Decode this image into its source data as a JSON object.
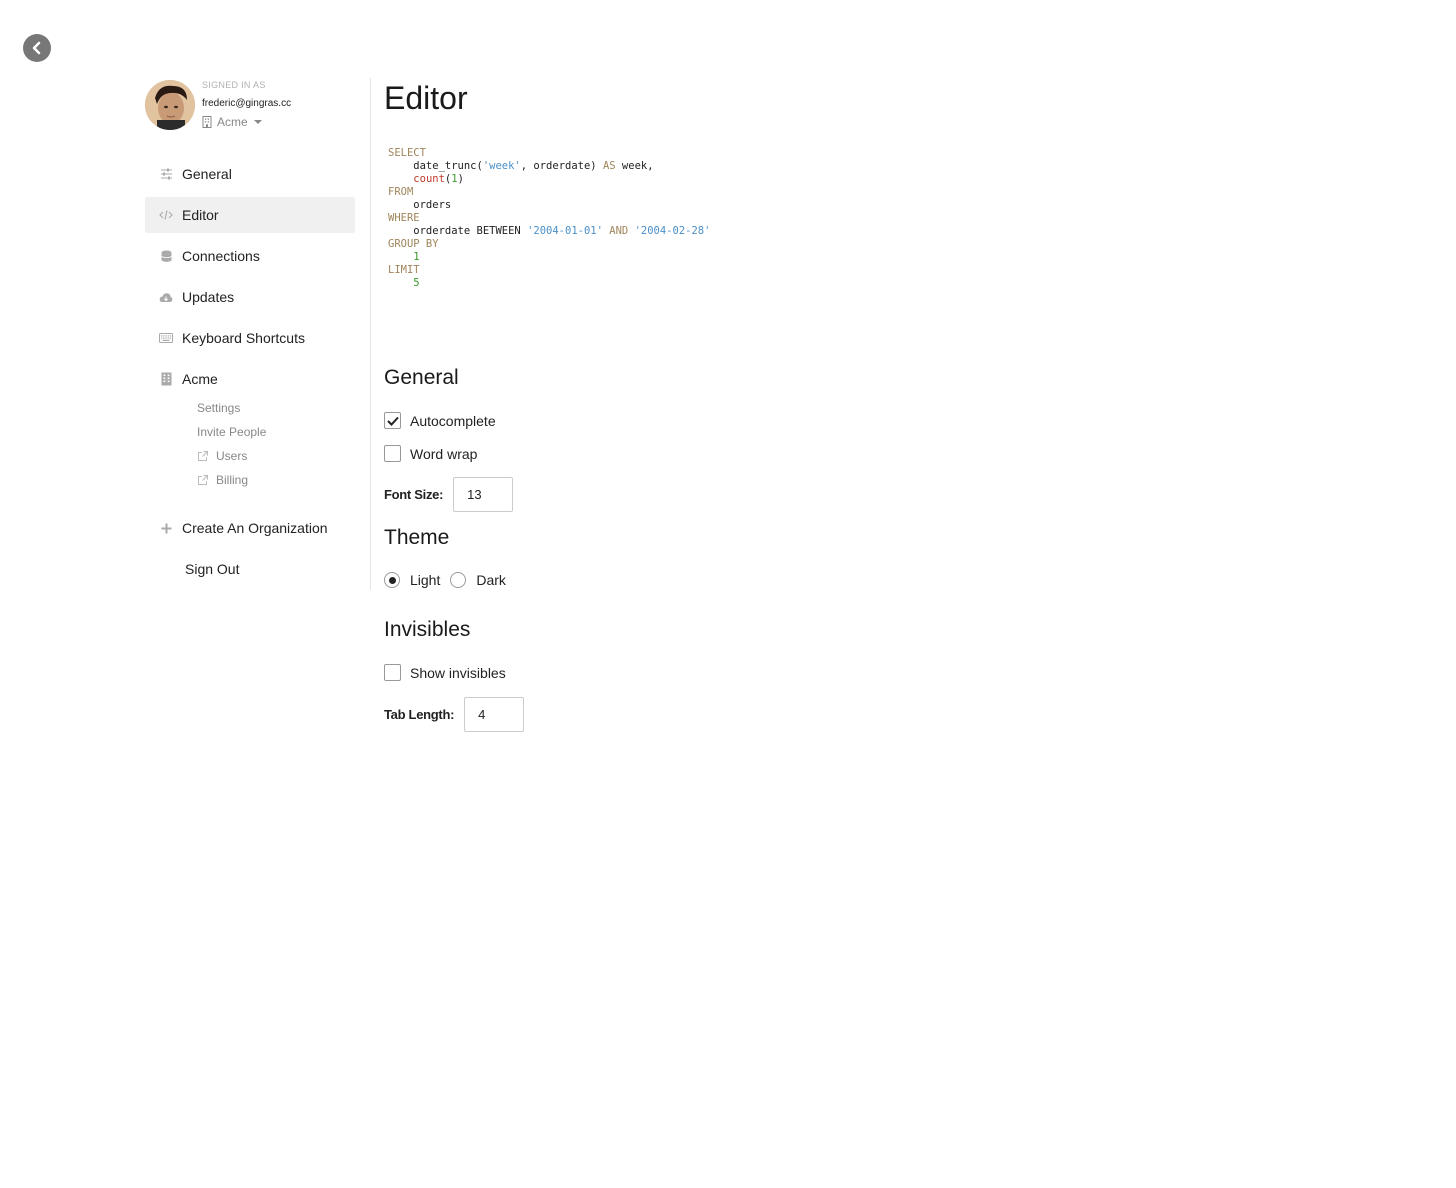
{
  "back_button": {
    "icon": "chevron-left-icon"
  },
  "profile": {
    "signed_in_label": "SIGNED IN AS",
    "email": "frederic@gingras.cc",
    "organization": "Acme"
  },
  "sidebar": {
    "items": [
      {
        "label": "General",
        "icon": "sliders-icon"
      },
      {
        "label": "Editor",
        "icon": "code-icon",
        "active": true
      },
      {
        "label": "Connections",
        "icon": "database-icon"
      },
      {
        "label": "Updates",
        "icon": "cloud-download-icon"
      },
      {
        "label": "Keyboard Shortcuts",
        "icon": "keyboard-icon"
      },
      {
        "label": "Acme",
        "icon": "building-icon"
      }
    ],
    "subitems": [
      {
        "label": "Settings"
      },
      {
        "label": "Invite People"
      },
      {
        "label": "Users",
        "external": true
      },
      {
        "label": "Billing",
        "external": true
      }
    ],
    "create_org": "Create An Organization",
    "sign_out": "Sign Out"
  },
  "main": {
    "title": "Editor",
    "code_preview": [
      "SELECT",
      "    date_trunc('week', orderdate) AS week,",
      "    count(1)",
      "FROM",
      "    orders",
      "WHERE",
      "    orderdate BETWEEN '2004-01-01' AND '2004-02-28'",
      "GROUP BY",
      "    1",
      "LIMIT",
      "    5"
    ],
    "general": {
      "title": "General",
      "autocomplete_label": "Autocomplete",
      "autocomplete_checked": true,
      "word_wrap_label": "Word wrap",
      "word_wrap_checked": false,
      "font_size_label": "Font Size:",
      "font_size_value": "13"
    },
    "theme": {
      "title": "Theme",
      "options": [
        "Light",
        "Dark"
      ],
      "selected": "Light"
    },
    "invisibles": {
      "title": "Invisibles",
      "show_invisibles_label": "Show invisibles",
      "show_invisibles_checked": false,
      "tab_length_label": "Tab Length:",
      "tab_length_value": "4"
    }
  },
  "colors": {
    "sql_keyword": "#a0855b",
    "sql_string": "#4a90c9",
    "sql_function": "#c0392b",
    "sql_number": "#3a9a2a",
    "active_nav_bg": "#f0f0f0"
  }
}
